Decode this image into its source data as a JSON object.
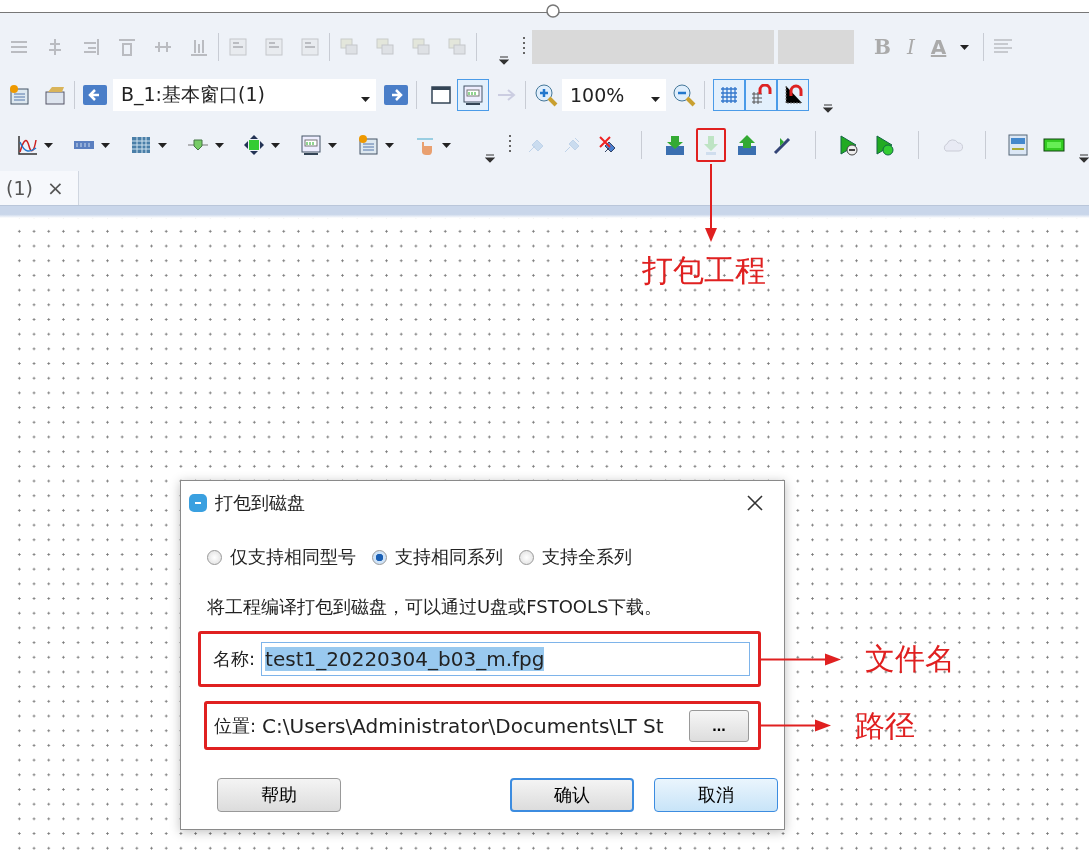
{
  "format_toolbar": {
    "disabled": true,
    "buttons": [
      {
        "kind": "bold",
        "label": "B"
      },
      {
        "kind": "italic",
        "label": "I"
      },
      {
        "kind": "color",
        "label": "A"
      }
    ]
  },
  "window_selector": {
    "value": "B_1:基本窗口(1)"
  },
  "view_toggles": [
    {
      "kind": "window",
      "on": false
    },
    {
      "kind": "panel",
      "on": true
    }
  ],
  "zoom": {
    "value": "100%"
  },
  "snap_toggles": [
    {
      "kind": "grid",
      "on": true
    },
    {
      "kind": "snap",
      "on": true
    },
    {
      "kind": "axis",
      "on": true
    }
  ],
  "tools": [
    {
      "kind": "chart",
      "menu": true,
      "disabled": false
    },
    {
      "kind": "meter",
      "menu": true,
      "disabled": false
    },
    {
      "kind": "table",
      "menu": true,
      "disabled": false
    },
    {
      "kind": "valve",
      "menu": true,
      "disabled": false
    },
    {
      "kind": "move",
      "menu": true,
      "disabled": false
    },
    {
      "kind": "panel",
      "menu": true,
      "disabled": false
    },
    {
      "kind": "alarm",
      "menu": true,
      "disabled": false
    },
    {
      "kind": "hand",
      "menu": true,
      "disabled": false
    }
  ],
  "device_tools": [
    {
      "kind": "link",
      "disabled": true
    },
    {
      "kind": "unlink",
      "disabled": true
    },
    {
      "kind": "cut",
      "disabled": false
    },
    {
      "kind": "sep"
    },
    {
      "kind": "download",
      "disabled": false
    },
    {
      "kind": "pack",
      "disabled": true,
      "callout": "打包工程"
    },
    {
      "kind": "upload",
      "disabled": false
    },
    {
      "kind": "transfer",
      "disabled": false
    },
    {
      "kind": "sep"
    },
    {
      "kind": "stop",
      "disabled": false
    },
    {
      "kind": "run",
      "disabled": false
    },
    {
      "kind": "sep"
    },
    {
      "kind": "cloud",
      "disabled": true
    },
    {
      "kind": "sep"
    },
    {
      "kind": "csv",
      "disabled": false
    },
    {
      "kind": "ram",
      "disabled": false
    }
  ],
  "document_tab": {
    "label": "(1)",
    "close": "×"
  },
  "dialog": {
    "title": "打包到磁盘",
    "options": [
      {
        "label": "仅支持相同型号",
        "selected": false
      },
      {
        "label": "支持相同系列",
        "selected": true
      },
      {
        "label": "支持全系列",
        "selected": false
      }
    ],
    "description": "将工程编译打包到磁盘，可以通过U盘或FSTOOLS下载。",
    "name_field": {
      "label": "名称:",
      "value": "test1_20220304_b03_m.fpg",
      "text_selected": true,
      "callout": "文件名"
    },
    "location_field": {
      "label": "位置:",
      "value": "C:\\Users\\Administrator\\Documents\\LT St",
      "browse": "...",
      "callout": "路径"
    },
    "buttons": [
      {
        "label": "帮助",
        "default": false,
        "hovered": false
      },
      {
        "label": "确认",
        "default": true,
        "hovered": false
      },
      {
        "label": "取消",
        "default": false,
        "hovered": true
      }
    ]
  }
}
